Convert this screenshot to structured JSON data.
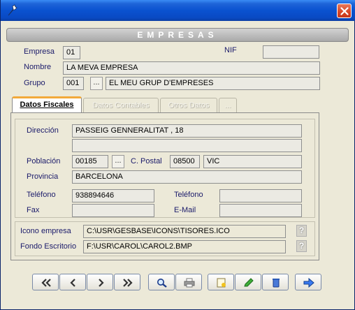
{
  "window": {
    "title_icon": "wrench-icon",
    "close_icon": "close-icon"
  },
  "header": {
    "title": "EMPRESAS"
  },
  "company": {
    "empresa_label": "Empresa",
    "empresa_value": "01",
    "nif_label": "NIF",
    "nif_value": "",
    "nombre_label": "Nombre",
    "nombre_value": "LA MEVA EMPRESA",
    "grupo_label": "Grupo",
    "grupo_code": "001",
    "grupo_name": "EL MEU GRUP D'EMPRESES",
    "lookup_label": "..."
  },
  "tabs": [
    {
      "label": "Datos Fiscales",
      "active": true
    },
    {
      "label": "Datos Contables",
      "active": false
    },
    {
      "label": "Otros Datos",
      "active": false
    },
    {
      "label": "...",
      "active": false
    }
  ],
  "fiscal": {
    "direccion_label": "Dirección",
    "direccion_1": "PASSEIG GENNERALITAT , 18",
    "direccion_2": "",
    "poblacion_label": "Población",
    "poblacion_code": "00185",
    "lookup_label": "...",
    "cpostal_label": "C. Postal",
    "cpostal_value": "08500",
    "ciudad_value": "VIC",
    "provincia_label": "Provincia",
    "provincia_value": "BARCELONA",
    "telefono1_label": "Teléfono",
    "telefono1_value": "938894646",
    "telefono2_label": "Teléfono",
    "telefono2_value": "",
    "fax_label": "Fax",
    "fax_value": "",
    "email_label": "E-Mail",
    "email_value": ""
  },
  "files": {
    "icono_label": "Icono empresa",
    "icono_value": "C:\\USR\\GESBASE\\ICONS\\TISORES.ICO",
    "fondo_label": "Fondo Escritorio",
    "fondo_value": "F:\\USR\\CAROL\\CAROL2.BMP",
    "help_label": "?"
  },
  "toolbar": {
    "buttons": [
      "first-icon",
      "prev-icon",
      "next-icon",
      "last-icon",
      "search-icon",
      "print-icon",
      "new-icon",
      "edit-icon",
      "delete-icon",
      "exit-icon"
    ]
  },
  "colors": {
    "title_bar": "#0a52d0",
    "close": "#d84626",
    "panel": "#ece9d8",
    "label": "#1a1a6a",
    "tab_accent": "#f2a93a"
  }
}
